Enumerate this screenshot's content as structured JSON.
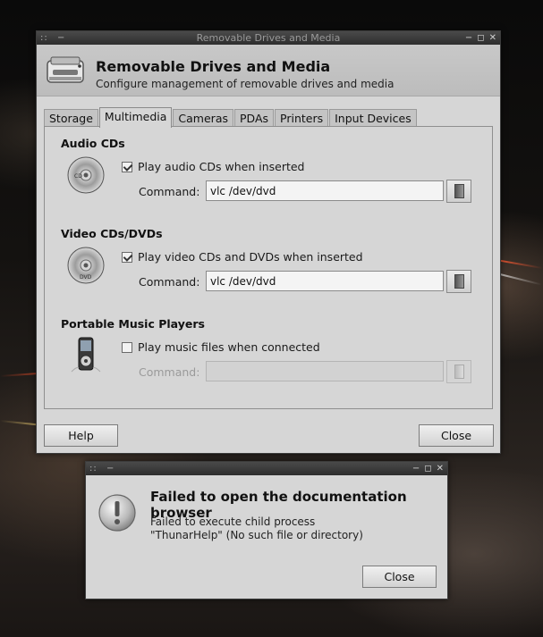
{
  "main_window": {
    "titlebar_text": "Removable Drives and Media",
    "header_title": "Removable Drives and Media",
    "header_subtitle": "Configure management of removable drives and media",
    "tabs": [
      {
        "label": "Storage",
        "active": false
      },
      {
        "label": "Multimedia",
        "active": true
      },
      {
        "label": "Cameras",
        "active": false
      },
      {
        "label": "PDAs",
        "active": false
      },
      {
        "label": "Printers",
        "active": false
      },
      {
        "label": "Input Devices",
        "active": false
      }
    ],
    "sections": {
      "audio": {
        "title": "Audio CDs",
        "checkbox_label": "Play audio CDs when inserted",
        "checked": true,
        "command_label": "Command:",
        "command_value": "vlc /dev/dvd"
      },
      "video": {
        "title": "Video CDs/DVDs",
        "checkbox_label": "Play video CDs and DVDs when inserted",
        "checked": true,
        "command_label": "Command:",
        "command_value": "vlc /dev/dvd"
      },
      "music": {
        "title": "Portable Music Players",
        "checkbox_label": "Play music files when connected",
        "checked": false,
        "command_label": "Command:",
        "command_value": ""
      }
    },
    "help_button": "Help",
    "close_button": "Close"
  },
  "error_dialog": {
    "heading": "Failed to open the documentation browser",
    "message_line1": "Failed to execute child process",
    "message_line2": "\"ThunarHelp\" (No such file or directory)",
    "close_button": "Close"
  },
  "titlebar_controls": {
    "menu": "::",
    "shade": "−",
    "minimize": "▫",
    "maximize": "◻",
    "close": "✕"
  },
  "colors": {
    "window_bg": "#d6d6d6",
    "titlebar_bg": "#2e2e2e",
    "titlebar_text": "#9a9a9a"
  }
}
